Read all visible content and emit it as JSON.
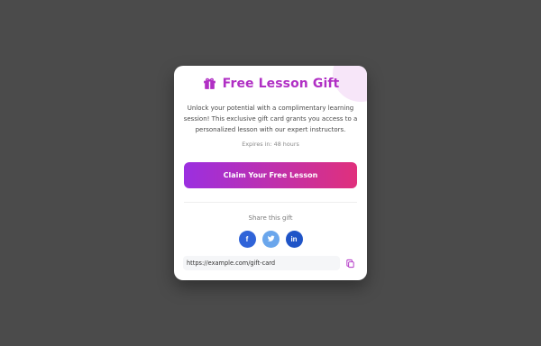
{
  "card": {
    "title": "Free Lesson Gift",
    "description": "Unlock your potential with a complimentary learning session! This exclusive gift card grants you access to a personalized lesson with our expert instructors.",
    "expires": "Expires in: 48 hours",
    "claim_label": "Claim Your Free Lesson",
    "share_label": "Share this gift",
    "social": [
      {
        "name": "facebook",
        "glyph": "f"
      },
      {
        "name": "twitter",
        "glyph": "t"
      },
      {
        "name": "linkedin",
        "glyph": "in"
      }
    ],
    "share_url": "https://example.com/gift-card",
    "icons": {
      "title_icon": "gift-icon",
      "copy_icon": "copy-icon"
    }
  },
  "colors": {
    "background": "#4b4b4b",
    "title": "#b02fc4",
    "button_gradient_start": "#9b2fe0",
    "button_gradient_end": "#e0307c",
    "facebook": "#2f63d8",
    "twitter": "#6aa6ec",
    "linkedin": "#1f54c7"
  }
}
